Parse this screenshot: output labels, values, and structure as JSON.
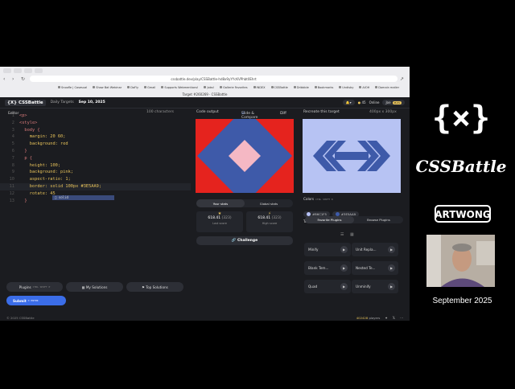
{
  "browser": {
    "url": "cssbattle.dev/play/CSSBattle-hd8x9yYYcKVPhbt0Ehrt",
    "tab_title": "Target #260269 · CSSBattle",
    "bookmarks": [
      "Snoofle | Casesual",
      "Shaw Bat Webinar",
      "DaFly",
      "Gmail",
      "Supports Webmentions!",
      "Jobs!",
      "Gallerie Favorites",
      "INDEX",
      "CSSBattle",
      "Dribbble",
      "Bookmarks",
      "Undisby",
      "AIOH",
      "Domain mailer"
    ]
  },
  "app": {
    "logo": "{X} CSSBattle",
    "daily_label": "Daily Targets",
    "date": "Sep 10, 2025",
    "points": "45",
    "online": "Online",
    "user": "Joe",
    "badge": "PLUS"
  },
  "editor": {
    "title": "Editor",
    "shortcut": "CTRL SHIFT E",
    "char_count": "100 characters",
    "lines": [
      {
        "n": "1",
        "text": "<p>"
      },
      {
        "n": "2",
        "text": "<style>"
      },
      {
        "n": "3",
        "text": "  body {"
      },
      {
        "n": "4",
        "text": "    margin: 20 60;"
      },
      {
        "n": "5",
        "text": "    background: red"
      },
      {
        "n": "6",
        "text": "  }"
      },
      {
        "n": "7",
        "text": "  p {"
      },
      {
        "n": "8",
        "text": "    height: 100;"
      },
      {
        "n": "9",
        "text": "    background: pink;"
      },
      {
        "n": "10",
        "text": "    aspect-ratio: 1;"
      },
      {
        "n": "11",
        "text": "    border: solid 100px #3E5AA9;"
      },
      {
        "n": "12",
        "text": "    rotate: 45"
      },
      {
        "n": "13",
        "text": "  }"
      }
    ],
    "autocomplete": "solid"
  },
  "output": {
    "title": "Code output",
    "slide_compare": "Slide & Compare",
    "diff": "Diff"
  },
  "target": {
    "title": "Recreate this target",
    "size": "400px x 300px"
  },
  "stats": {
    "tabs": [
      "Your stats",
      "Global stats"
    ],
    "your": {
      "score": "618.41",
      "chars": "(323)",
      "label": "Last score"
    },
    "global": {
      "score": "618.41",
      "chars": "(323)",
      "label": "High score"
    },
    "challenge": "Challenge"
  },
  "colors": {
    "title": "Colors",
    "shortcut": "CTRL SHIFT K",
    "items": [
      {
        "hex": "#B6C1F5",
        "label": "#B6C1F5"
      },
      {
        "hex": "#3E5AA9",
        "label": "#3E5AA9"
      }
    ]
  },
  "toolbox": {
    "title": "Toolbox",
    "shortcut": "CTRL SHIFT T",
    "tabs": [
      "Favorite Plugins",
      "Browse Plugins"
    ],
    "plugins": [
      "Minify",
      "Unit Repla...",
      "Blank Tem...",
      "Nested Te...",
      "Quad",
      "Unminify"
    ]
  },
  "bottom": {
    "plugins": "Plugins",
    "plugins_shortcut": "CTRL SHIFT P",
    "my_solutions": "My Solutions",
    "top_solutions": "Top Solutions",
    "submit": "Submit",
    "submit_shortcut": "⌘ ENTER"
  },
  "footer": {
    "copyright": "© 2025 CSSBattle",
    "players": "402428",
    "players_label": "players"
  },
  "sidebar": {
    "brand1": "{×}",
    "brand2": "CSSBattle",
    "brand3": "ARTWONG",
    "month": "September 2025"
  }
}
